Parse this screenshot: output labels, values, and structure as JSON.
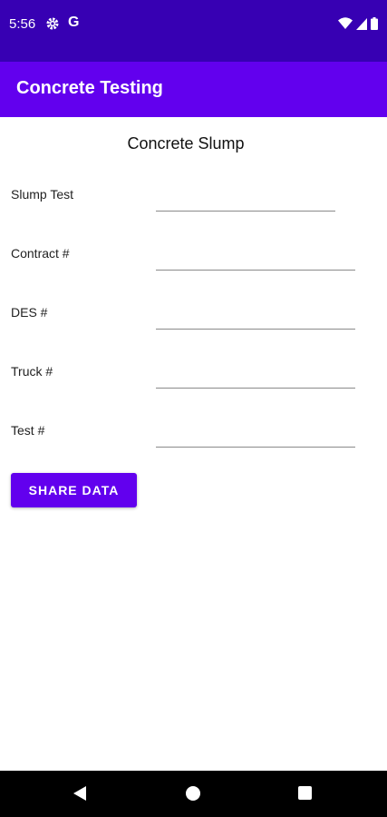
{
  "status_bar": {
    "time": "5:56",
    "g_label": "G",
    "icons": [
      "gear-icon",
      "wifi-icon",
      "signal-icon",
      "battery-icon"
    ]
  },
  "app_bar": {
    "title": "Concrete Testing"
  },
  "screen": {
    "heading": "Concrete Slump"
  },
  "form": {
    "fields": [
      {
        "label": "Slump Test",
        "value": "",
        "placeholder": ""
      },
      {
        "label": "Contract #",
        "value": "",
        "placeholder": ""
      },
      {
        "label": "DES #",
        "value": "",
        "placeholder": ""
      },
      {
        "label": "Truck #",
        "value": "",
        "placeholder": ""
      },
      {
        "label": "Test #",
        "value": "",
        "placeholder": ""
      }
    ]
  },
  "actions": {
    "share_label": "SHARE DATA"
  },
  "nav_bar": {
    "icons": [
      "back-icon",
      "home-icon",
      "recents-icon"
    ]
  },
  "colors": {
    "status_bar": "#3700b3",
    "primary": "#6200ee",
    "nav_bar": "#000000"
  }
}
